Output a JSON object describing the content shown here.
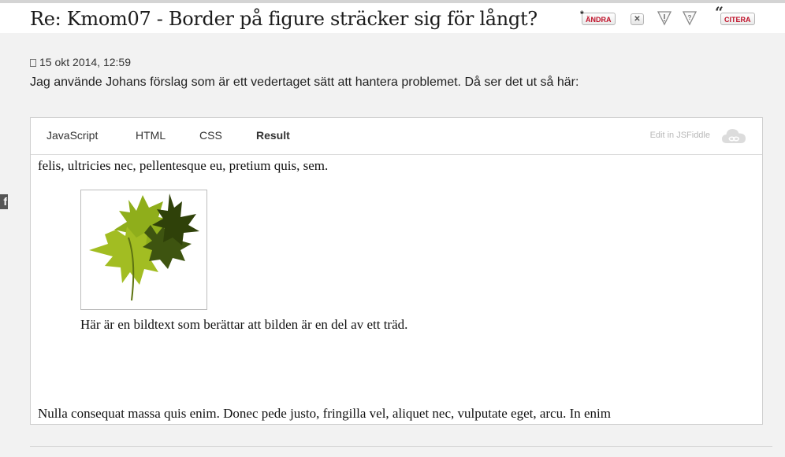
{
  "post": {
    "title": "Re: Kmom07 - Border på figure sträcker sig för långt?",
    "date": "15 okt 2014, 12:59",
    "text": "Jag använde Johans förslag som är ett vedertaget sätt att hantera problemet. Då ser det ut så här:"
  },
  "actions": {
    "edit_label": "ÄNDRA",
    "delete_icon": "x-icon",
    "report_icon": "exclamation-icon",
    "question_icon": "question-icon",
    "quote_label": "CITERA"
  },
  "social": {
    "facebook_label": "f"
  },
  "jsfiddle": {
    "tabs": [
      "JavaScript",
      "HTML",
      "CSS",
      "Result"
    ],
    "active_tab": "Result",
    "edit_link": "Edit in JSFiddle",
    "result": {
      "top_text": "felis, ultricies nec, pellentesque eu, pretium quis, sem.",
      "caption": "Här är en bildtext som berättar att bilden är en del av ett träd.",
      "bottom_text": "Nulla consequat massa quis enim. Donec pede justo, fringilla vel, aliquet nec, vulputate eget, arcu. In enim"
    }
  },
  "colors": {
    "accent_red": "#c0122a",
    "leaf_light": "#8fae1b",
    "leaf_dark": "#3e5410"
  }
}
